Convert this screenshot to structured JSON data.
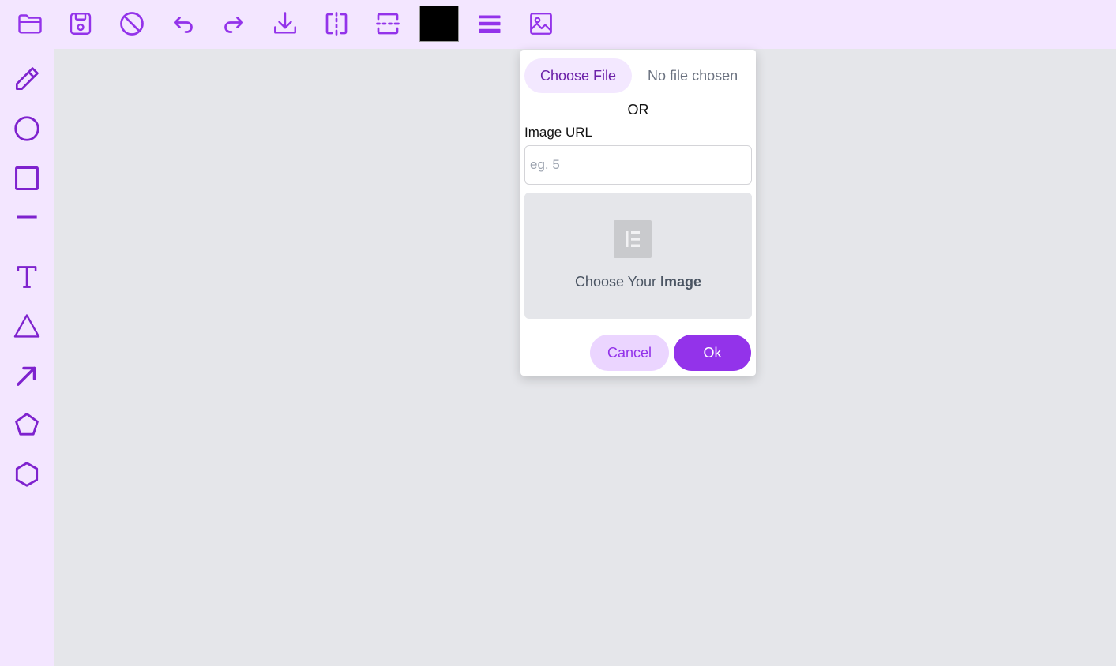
{
  "colors": {
    "accent": "#9333ea",
    "accent_dark": "#6b21a8",
    "panel_bg": "#f3e6ff",
    "canvas_bg": "#e5e6ea",
    "current_color": "#000000"
  },
  "toolbar": {
    "items": [
      {
        "icon": "folder-open-icon"
      },
      {
        "icon": "save-icon"
      },
      {
        "icon": "clear-icon"
      },
      {
        "icon": "undo-icon"
      },
      {
        "icon": "redo-icon"
      },
      {
        "icon": "download-icon"
      },
      {
        "icon": "flip-horizontal-icon"
      },
      {
        "icon": "flip-vertical-icon"
      },
      {
        "icon": "color-swatch",
        "value": "#000000"
      },
      {
        "icon": "line-width-icon"
      },
      {
        "icon": "image-icon"
      }
    ]
  },
  "sidebar": {
    "tools": [
      {
        "icon": "pencil-icon"
      },
      {
        "icon": "circle-icon"
      },
      {
        "icon": "square-icon"
      },
      {
        "icon": "line-icon"
      },
      {
        "icon": "text-icon"
      },
      {
        "icon": "triangle-icon"
      },
      {
        "icon": "arrow-icon"
      },
      {
        "icon": "pentagon-icon"
      },
      {
        "icon": "hexagon-icon"
      }
    ]
  },
  "dialog": {
    "choose_file_label": "Choose File",
    "no_file_text": "No file chosen",
    "or_text": "OR",
    "url_label": "Image URL",
    "url_value": "",
    "url_placeholder": "eg. 5",
    "drop_text_prefix": "Choose Your ",
    "drop_text_bold": "Image",
    "cancel_label": "Cancel",
    "ok_label": "Ok"
  }
}
